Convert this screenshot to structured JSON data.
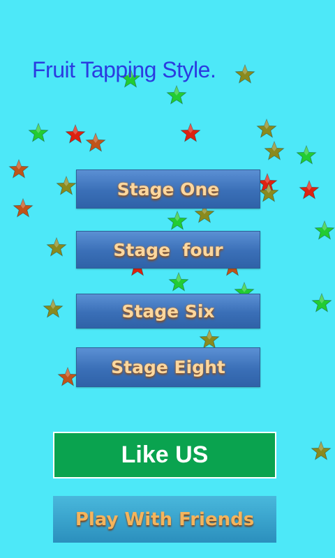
{
  "title": "Fruit Tapping Style.",
  "menu": {
    "stages": [
      {
        "label": "Stage One"
      },
      {
        "label": "Stage  four"
      },
      {
        "label": "Stage Six"
      },
      {
        "label": "Stage Eight"
      }
    ],
    "like_label": "Like US",
    "friends_label": "Play With Friends"
  },
  "colors": {
    "background": "#4de8f8",
    "title": "#2b3be0",
    "stage_button": "#3a6fb7",
    "stage_text": "#fbd79e",
    "like_button": "#0aa34f",
    "friends_button": "#2b8fbd",
    "star_green": "#22cc33",
    "star_red": "#dd2211",
    "star_olive": "#8a8a1e",
    "star_brown": "#c0541a"
  },
  "stars": [
    {
      "color": "green"
    },
    {
      "color": "olive"
    },
    {
      "color": "green"
    },
    {
      "color": "red"
    },
    {
      "color": "green"
    },
    {
      "color": "red"
    },
    {
      "color": "brown"
    },
    {
      "color": "olive"
    },
    {
      "color": "olive"
    },
    {
      "color": "green"
    },
    {
      "color": "brown"
    },
    {
      "color": "red"
    },
    {
      "color": "olive"
    },
    {
      "color": "red"
    },
    {
      "color": "olive"
    },
    {
      "color": "brown"
    },
    {
      "color": "olive"
    },
    {
      "color": "green"
    },
    {
      "color": "green"
    },
    {
      "color": "olive"
    },
    {
      "color": "red"
    },
    {
      "color": "green"
    },
    {
      "color": "brown"
    },
    {
      "color": "green"
    },
    {
      "color": "olive"
    },
    {
      "color": "green"
    },
    {
      "color": "olive"
    },
    {
      "color": "brown"
    },
    {
      "color": "olive"
    }
  ]
}
